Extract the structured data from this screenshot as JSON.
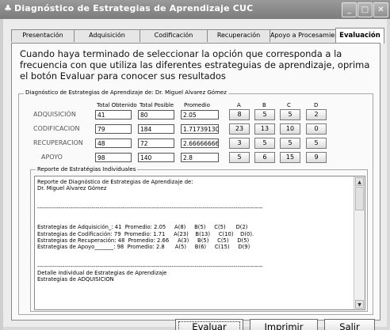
{
  "window": {
    "title": "Diagnóstico de Estrategias de Aprendizaje  CUC",
    "app_icon": "♣",
    "controls": {
      "minimize": "_",
      "maximize": "□",
      "close": "✕"
    }
  },
  "tabs": [
    {
      "label": "Presentación",
      "active": false
    },
    {
      "label": "Adquisición",
      "active": false
    },
    {
      "label": "Codificación",
      "active": false
    },
    {
      "label": "Recuperación",
      "active": false
    },
    {
      "label": "Apoyo a Procesamiento",
      "active": false
    },
    {
      "label": "Evaluación",
      "active": true
    }
  ],
  "intro_text": "Cuando haya terminado de seleccionar la opción que corresponda a la frecuencia con que utiliza las diferentes estrateguias de aprendizaje, oprima el botón Evaluar para conocer sus resultados",
  "diagnostic": {
    "legend": "Diagnóstico de Estrategias de Aprendizaje de:  Dr. Miguel Alvarez Gómez",
    "headers": {
      "total_obtenido": "Total Obtenido",
      "total_posible": "Total Posible",
      "promedio": "Promedio",
      "a": "A",
      "b": "B",
      "c": "C",
      "d": "D"
    },
    "rows": [
      {
        "label": "ADQUISICIÓN",
        "obtenido": "41",
        "posible": "80",
        "promedio": "2.05",
        "a": "8",
        "b": "5",
        "c": "5",
        "d": "2"
      },
      {
        "label": "CODIFICACION",
        "obtenido": "79",
        "posible": "184",
        "promedio": "1.71739130",
        "a": "23",
        "b": "13",
        "c": "10",
        "d": "0"
      },
      {
        "label": "RECUPERACION",
        "obtenido": "48",
        "posible": "72",
        "promedio": "2.66666666",
        "a": "3",
        "b": "5",
        "c": "5",
        "d": "5"
      },
      {
        "label": "APOYO",
        "obtenido": "98",
        "posible": "140",
        "promedio": "2.8",
        "a": "5",
        "b": "6",
        "c": "15",
        "d": "9"
      }
    ]
  },
  "report": {
    "legend": "Reporte de Estratégias Individuales",
    "text": "Reporte de Diagnóstico de Estrategias de Aprendizaje de:\nDr. Miguel Alvarez Gómez\n\n\n--------------------------------------------------------------------------------------------------------------------\n\n\nEstrategias de Adquisición_: 41  Promedio: 2.05     A(8)     B(5)     C(5)      D(2)\nEstrategias de Codificación: 79  Promedio: 1.71     A(23)    B(13)     C(10)    D(0).\nEstrategias de Recuperación: 48  Promedio: 2.66     A(3)     B(5)     C(5)     D(5)\nEstrategias de Apoyo_______: 98  Promedio: 2.8      A(5)     B(6)     C(15)     D(9)\n\n\n--------------------------------------------------------------------------------------------------------------------\nDetalle individual de Estrategias de Aprendizaje\nEstrategias de ADQUISICION"
  },
  "buttons": {
    "evaluar": "Evaluar",
    "imprimir": "Imprimir",
    "salir": "Salir"
  },
  "scrollbar": {
    "up": "▲",
    "down": "▼"
  }
}
